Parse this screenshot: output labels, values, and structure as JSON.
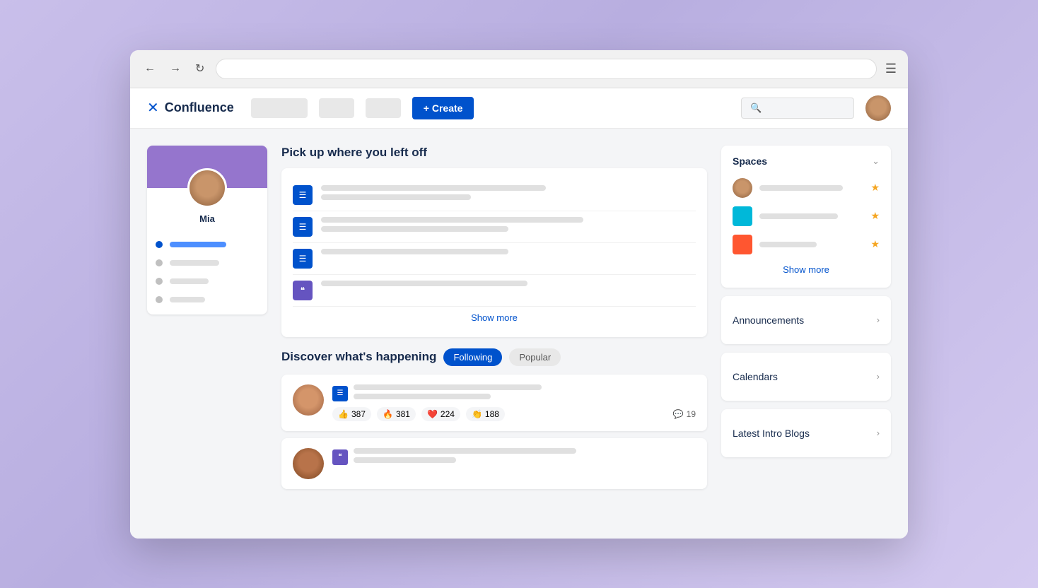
{
  "browser": {
    "url": "",
    "menu_label": "☰"
  },
  "header": {
    "logo_icon": "✕",
    "logo_text": "Confluence",
    "nav_items": [
      "",
      "",
      ""
    ],
    "create_label": "+ Create",
    "search_placeholder": ""
  },
  "profile": {
    "name": "Mia",
    "nav_items": [
      "",
      "",
      ""
    ]
  },
  "pick_up": {
    "title": "Pick up where you left off",
    "show_more": "Show more",
    "items": [
      {
        "type": "list",
        "lines": [
          {
            "w": "60%"
          },
          {
            "w": "40%"
          }
        ]
      },
      {
        "type": "list",
        "lines": [
          {
            "w": "70%"
          },
          {
            "w": "50%"
          }
        ]
      },
      {
        "type": "list",
        "lines": [
          {
            "w": "50%"
          },
          {
            "w": "35%"
          }
        ]
      },
      {
        "type": "quote",
        "lines": [
          {
            "w": "55%"
          }
        ]
      }
    ]
  },
  "discover": {
    "title": "Discover what's happening",
    "tabs": [
      {
        "label": "Following",
        "active": true
      },
      {
        "label": "Popular",
        "active": false
      }
    ],
    "posts": [
      {
        "type": "list",
        "reactions": [
          {
            "emoji": "👍",
            "count": "387"
          },
          {
            "emoji": "🔥",
            "count": "381"
          },
          {
            "emoji": "❤️",
            "count": "224"
          },
          {
            "emoji": "👏",
            "count": "188"
          }
        ],
        "comments": "19"
      },
      {
        "type": "quote",
        "reactions": []
      }
    ]
  },
  "right_sidebar": {
    "spaces": {
      "title": "Spaces",
      "show_more": "Show more",
      "items": [
        {
          "color": "#a0826d",
          "type": "person"
        },
        {
          "color": "#00b8d9",
          "type": "teal"
        },
        {
          "color": "#ff5630",
          "type": "red"
        }
      ]
    },
    "announcements": {
      "title": "Announcements"
    },
    "calendars": {
      "title": "Calendars"
    },
    "latest_intro_blogs": {
      "title": "Latest Intro Blogs"
    }
  }
}
